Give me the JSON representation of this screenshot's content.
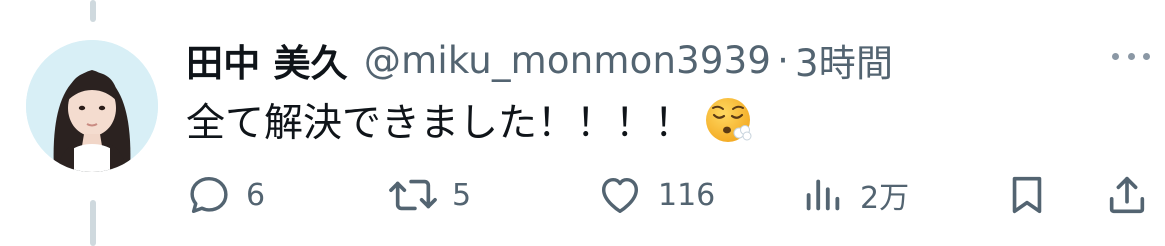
{
  "tweet": {
    "display_name": "田中 美久",
    "handle": "@miku_monmon3939",
    "separator": "·",
    "timestamp": "3時間",
    "text": "全て解決できました！！！！",
    "emoji": "exhaling-face-emoji"
  },
  "actions": {
    "reply_count": "6",
    "retweet_count": "5",
    "like_count": "116",
    "views_count": "2万"
  },
  "icons": {
    "reply": "reply-icon",
    "retweet": "retweet-icon",
    "like": "heart-icon",
    "views": "views-icon",
    "bookmark": "bookmark-icon",
    "share": "share-icon",
    "more": "more-icon"
  },
  "colors": {
    "text": "#0f1419",
    "secondary": "#536471",
    "thread_line": "#cfd9de"
  }
}
